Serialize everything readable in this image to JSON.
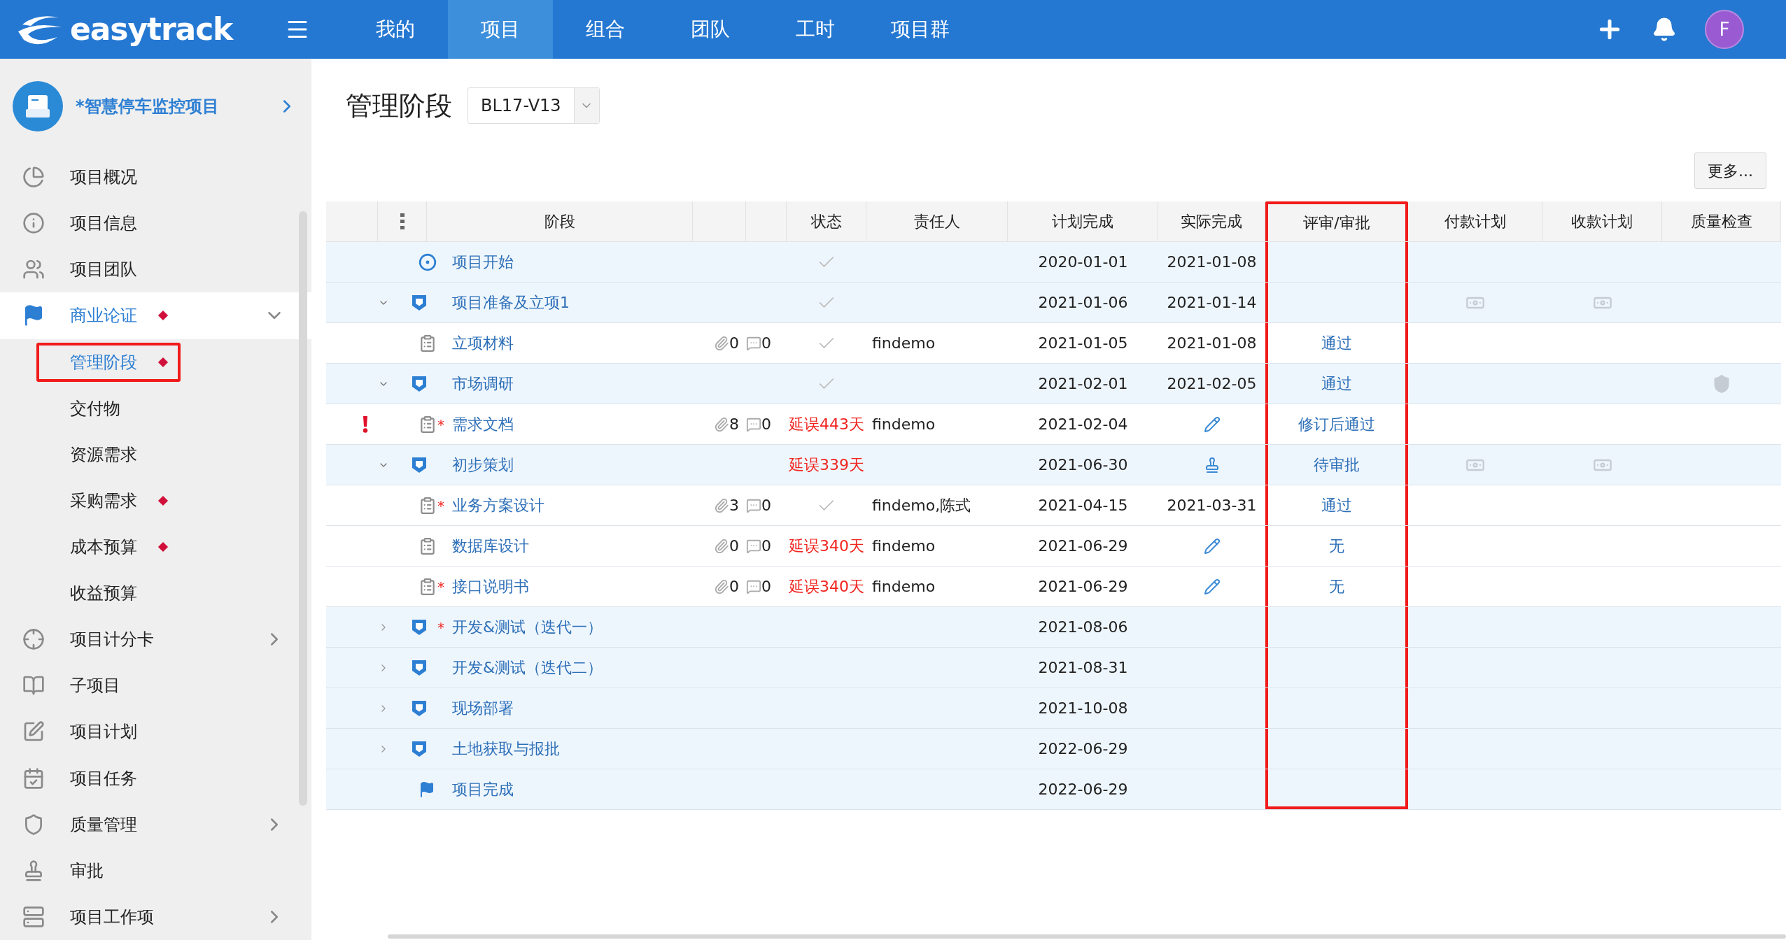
{
  "topbar": {
    "logo": "easytrack",
    "nav": [
      {
        "label": "我的",
        "selected": false
      },
      {
        "label": "项目",
        "selected": true
      },
      {
        "label": "组合",
        "selected": false
      },
      {
        "label": "团队",
        "selected": false
      },
      {
        "label": "工时",
        "selected": false
      },
      {
        "label": "项目群",
        "selected": false
      }
    ],
    "avatar": "F"
  },
  "sidebar": {
    "project": "*智慧停车监控项目",
    "items": [
      {
        "label": "项目概况",
        "selected": false,
        "marked": false
      },
      {
        "label": "项目信息",
        "selected": false,
        "marked": false
      },
      {
        "label": "项目团队",
        "selected": false,
        "marked": false
      },
      {
        "label": "商业论证",
        "selected": true,
        "marked": true,
        "expanded": true,
        "children": [
          {
            "label": "管理阶段",
            "selected": true,
            "marked": true,
            "highlighted": true
          },
          {
            "label": "交付物",
            "selected": false,
            "marked": false,
            "highlighted": false
          },
          {
            "label": "资源需求",
            "selected": false,
            "marked": false,
            "highlighted": false
          },
          {
            "label": "采购需求",
            "selected": false,
            "marked": true,
            "highlighted": false
          },
          {
            "label": "成本预算",
            "selected": false,
            "marked": true,
            "highlighted": false
          },
          {
            "label": "收益预算",
            "selected": false,
            "marked": false,
            "highlighted": false
          }
        ]
      },
      {
        "label": "项目计分卡",
        "selected": false,
        "marked": false,
        "expanded": false
      },
      {
        "label": "子项目",
        "selected": false,
        "marked": false
      },
      {
        "label": "项目计划",
        "selected": false,
        "marked": false
      },
      {
        "label": "项目任务",
        "selected": false,
        "marked": false
      },
      {
        "label": "质量管理",
        "selected": false,
        "marked": false,
        "expanded": false
      },
      {
        "label": "审批",
        "selected": false,
        "marked": false
      },
      {
        "label": "项目工作项",
        "selected": false,
        "marked": false,
        "expanded": false
      }
    ]
  },
  "page": {
    "title": "管理阶段",
    "version": "BL17-V13",
    "more_button": "更多..."
  },
  "table": {
    "columns": [
      {
        "label": "阶段",
        "highlighted": false
      },
      {
        "label": "状态",
        "highlighted": false
      },
      {
        "label": "责任人",
        "highlighted": false
      },
      {
        "label": "计划完成",
        "highlighted": false
      },
      {
        "label": "实际完成",
        "highlighted": false
      },
      {
        "label": "评审/审批",
        "highlighted": true
      },
      {
        "label": "付款计划",
        "highlighted": false
      },
      {
        "label": "收款计划",
        "highlighted": false
      },
      {
        "label": "质量检查",
        "highlighted": false
      }
    ],
    "rows": [
      {
        "kind": "start",
        "name": "项目开始",
        "alert": false,
        "done": true,
        "planned": "2020-01-01",
        "actual": {
          "kind": "date",
          "text": "2021-01-08"
        }
      },
      {
        "kind": "phase",
        "name": "项目准备及立项1",
        "expanded": true,
        "alert": false,
        "done": true,
        "planned": "2021-01-06",
        "actual": {
          "kind": "date",
          "text": "2021-01-14"
        },
        "payment": true,
        "receipt": true
      },
      {
        "kind": "deliverable",
        "name": "立项材料",
        "alert": false,
        "attachments": "0",
        "comments": "0",
        "done": true,
        "owner": "findemo",
        "planned": "2021-01-05",
        "actual": {
          "kind": "date",
          "text": "2021-01-08"
        },
        "review": "通过"
      },
      {
        "kind": "phase",
        "name": "市场调研",
        "expanded": true,
        "alert": false,
        "done": true,
        "planned": "2021-02-01",
        "actual": {
          "kind": "date",
          "text": "2021-02-05"
        },
        "review": "通过",
        "quality": true
      },
      {
        "kind": "deliverable",
        "required_mark": "*",
        "name": "需求文档",
        "alert": true,
        "attachments": "8",
        "comments": "0",
        "done": false,
        "delay": "延误443天",
        "owner": "findemo",
        "planned": "2021-02-04",
        "actual": {
          "kind": "edit"
        },
        "review": "修订后通过"
      },
      {
        "kind": "phase",
        "name": "初步策划",
        "expanded": true,
        "alert": false,
        "done": false,
        "delay": "延误339天",
        "planned": "2021-06-30",
        "actual": {
          "kind": "approve"
        },
        "review": "待审批",
        "payment": true,
        "receipt": true
      },
      {
        "kind": "deliverable",
        "required_mark": "*",
        "name": "业务方案设计",
        "alert": false,
        "attachments": "3",
        "comments": "0",
        "done": true,
        "owner": "findemo,陈式",
        "planned": "2021-04-15",
        "actual": {
          "kind": "date",
          "text": "2021-03-31"
        },
        "review": "通过"
      },
      {
        "kind": "deliverable",
        "name": "数据库设计",
        "alert": false,
        "attachments": "0",
        "comments": "0",
        "done": false,
        "delay": "延误340天",
        "owner": "findemo",
        "planned": "2021-06-29",
        "actual": {
          "kind": "edit"
        },
        "review": "无"
      },
      {
        "kind": "deliverable",
        "required_mark": "*",
        "name": "接口说明书",
        "alert": false,
        "attachments": "0",
        "comments": "0",
        "done": false,
        "delay": "延误340天",
        "owner": "findemo",
        "planned": "2021-06-29",
        "actual": {
          "kind": "edit"
        },
        "review": "无"
      },
      {
        "kind": "phase",
        "required_mark": "*",
        "name": "开发&测试（迭代一）",
        "expanded": false,
        "alert": false,
        "done": false,
        "planned": "2021-08-06"
      },
      {
        "kind": "phase",
        "name": "开发&测试（迭代二）",
        "expanded": false,
        "alert": false,
        "done": false,
        "planned": "2021-08-31"
      },
      {
        "kind": "phase",
        "name": "现场部署",
        "expanded": false,
        "alert": false,
        "done": false,
        "planned": "2021-10-08"
      },
      {
        "kind": "phase",
        "name": "土地获取与报批",
        "expanded": false,
        "alert": false,
        "done": false,
        "planned": "2022-06-29"
      },
      {
        "kind": "end",
        "name": "项目完成",
        "alert": false,
        "done": false,
        "planned": "2022-06-29"
      }
    ]
  }
}
